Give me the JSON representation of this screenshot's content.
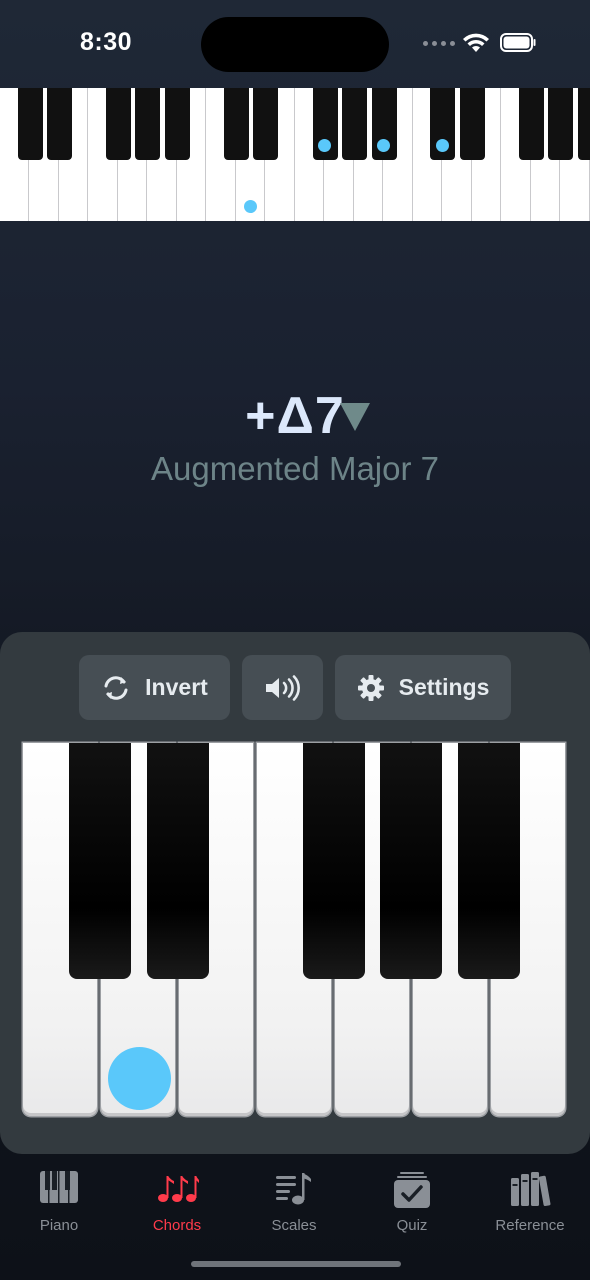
{
  "status_bar": {
    "time": "8:30"
  },
  "chord": {
    "symbol": "+Δ7",
    "name": "Augmented Major 7"
  },
  "toolbar": {
    "invert_label": "Invert",
    "settings_label": "Settings"
  },
  "tabs": [
    {
      "label": "Piano",
      "icon": "piano-icon"
    },
    {
      "label": "Chords",
      "icon": "chords-icon",
      "active": true
    },
    {
      "label": "Scales",
      "icon": "scales-icon"
    },
    {
      "label": "Quiz",
      "icon": "quiz-icon"
    },
    {
      "label": "Reference",
      "icon": "reference-icon"
    }
  ],
  "colors": {
    "accent": "#ff3b4b",
    "note_highlight": "#5ac8fa",
    "chord_symbol": "#dce8fb",
    "chord_name": "#6d8488"
  }
}
